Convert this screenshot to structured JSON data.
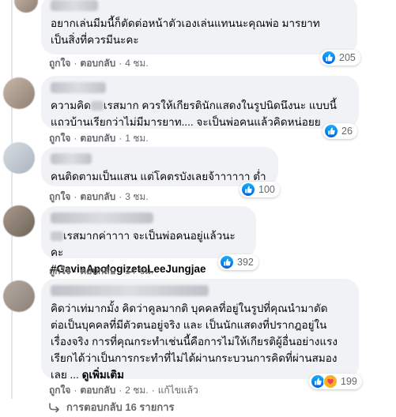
{
  "comments": [
    {
      "text": "อยากเล่นมีมนี้ก็ตัดต่อหน้าตัวเองเล่นแทนนะคุณพ่อ มารยาท\nเป็นสิ่งที่ควรมีนะคะ",
      "like_label": "ถูกใจ",
      "reply_label": "ตอบกลับ",
      "time": "4 ชม.",
      "reaction_count": "205",
      "reaction_icons": [
        "like-icon"
      ]
    },
    {
      "text_before": "ความคิด",
      "text_after": "เรสมาก ควรให้เกียรตินักแสดงในรูปนิดนึงนะ แบบนี้\nแถวบ้านเรียกว่าไม่มีมารยาท.... จะเป็นพ่อคนแล้วคิดหน่อยย",
      "like_label": "ถูกใจ",
      "reply_label": "ตอบกลับ",
      "time": "1 ชม.",
      "reaction_count": "26",
      "reaction_icons": [
        "like-icon"
      ]
    },
    {
      "text": "คนติดตามเป็นแสน แต่โคตรบังเลยจ้าาาาาา ต่ำ",
      "like_label": "ถูกใจ",
      "reply_label": "ตอบกลับ",
      "time": "3 ชม.",
      "reaction_count": "100",
      "reaction_icons": [
        "like-icon"
      ]
    },
    {
      "text_after": "เรสมากค่าาาา จะเป็นพ่อคนอยู่แล้วนะคะ",
      "hashtag": "#GavinApologizetoLeeJungjae",
      "like_label": "ถูกใจ",
      "reply_label": "ตอบกลับ",
      "time": "14 ชม.",
      "reaction_count": "392",
      "reaction_icons": [
        "like-icon"
      ]
    },
    {
      "text": "คิดว่าเท่มากมั้ง คิดว่าคูลมากติ บุคคลที่อยู่ในรูปที่คุณนำมาตัด\nต่อเป็นบุคคลที่มีตัวตนอยู่จริง และ เป็นนักแสดงที่ปรากฎอยู่ใน\nเรื่องจริง การที่คุณกระทำเช่นนี้คือการไม่ให้เกียรติผู้อื่นอย่างแรง\nเรียกได้ว่าเป็นการกระทำที่ไม่ได้ผ่านกระบวนการคิดที่ผ่านสมอง\nเลย ... ",
      "see_more": "ดูเพิ่มเติม",
      "like_label": "ถูกใจ",
      "reply_label": "ตอบกลับ",
      "time": "2 ชม.",
      "edited": "แก้ไขแล้ว",
      "reaction_count": "199",
      "reaction_icons": [
        "like-icon",
        "care-icon"
      ]
    }
  ],
  "replies_link": "การตอบกลับ 16 รายการ",
  "colors": {
    "bubble": "#f0f2f5",
    "secondary_text": "#65676b",
    "like_blue": "#1877f2"
  }
}
